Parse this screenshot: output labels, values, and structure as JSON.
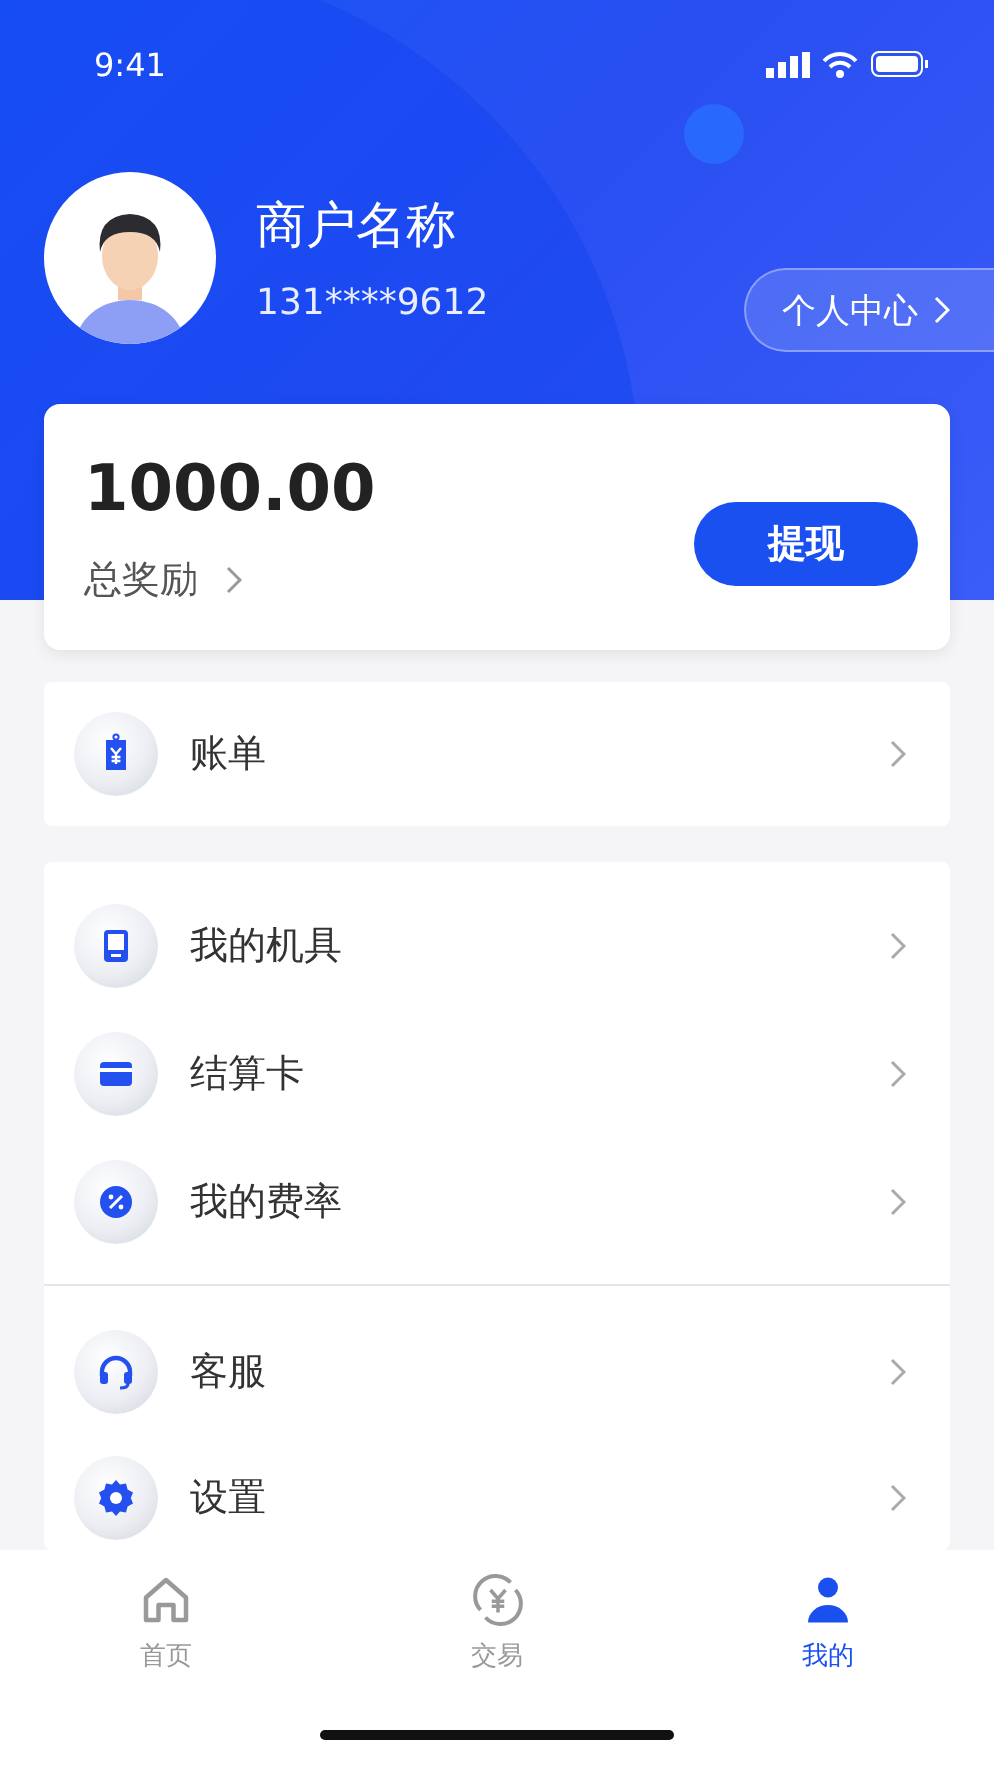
{
  "status_bar": {
    "time": "9:41"
  },
  "profile": {
    "name": "商户名称",
    "phone": "131****9612",
    "center_button": "个人中心"
  },
  "reward_card": {
    "amount": "1000.00",
    "label": "总奖励",
    "withdraw_button": "提现"
  },
  "menu_sections": [
    {
      "groups": [
        [
          "账单"
        ]
      ]
    },
    {
      "groups": [
        [
          "我的机具",
          "结算卡",
          "我的费率"
        ],
        [
          "客服",
          "设置"
        ]
      ]
    }
  ],
  "tabs": [
    {
      "label": "首页",
      "selected": false
    },
    {
      "label": "交易",
      "selected": false
    },
    {
      "label": "我的",
      "selected": true
    }
  ]
}
